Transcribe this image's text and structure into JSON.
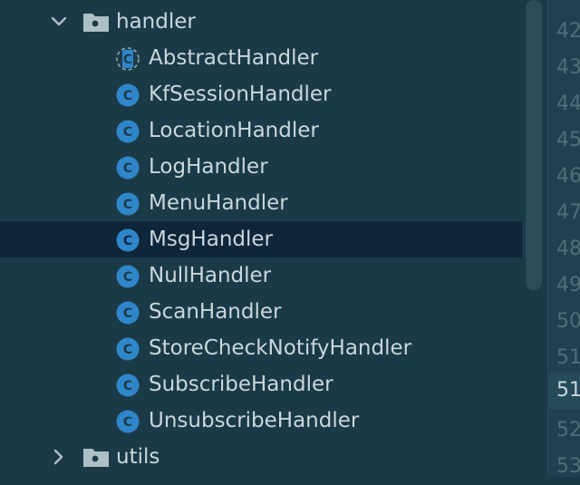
{
  "tree": {
    "folders": [
      {
        "label": "handler",
        "expanded": true
      },
      {
        "label": "utils",
        "expanded": false
      }
    ],
    "classes": [
      {
        "label": "AbstractHandler",
        "abstract": true
      },
      {
        "label": "KfSessionHandler"
      },
      {
        "label": "LocationHandler"
      },
      {
        "label": "LogHandler"
      },
      {
        "label": "MenuHandler"
      },
      {
        "label": "MsgHandler",
        "selected": true
      },
      {
        "label": "NullHandler"
      },
      {
        "label": "ScanHandler"
      },
      {
        "label": "StoreCheckNotifyHandler"
      },
      {
        "label": "SubscribeHandler"
      },
      {
        "label": "UnsubscribeHandler"
      }
    ]
  },
  "gutter": {
    "line_numbers": [
      "42",
      "43",
      "44",
      "45",
      "46",
      "47",
      "48",
      "49",
      "50",
      "51",
      "52",
      "53"
    ],
    "current_line": "51"
  },
  "colors": {
    "background": "#1b3a48",
    "selection": "#0e263a",
    "class_icon": "#2f86c9",
    "text": "#c9d7dd",
    "line_number": "#4f6e79"
  },
  "icons": {
    "folder": "package-folder-icon",
    "class": "class-icon",
    "abstract_class": "abstract-class-icon",
    "expanded": "chevron-down-icon",
    "collapsed": "chevron-right-icon"
  }
}
